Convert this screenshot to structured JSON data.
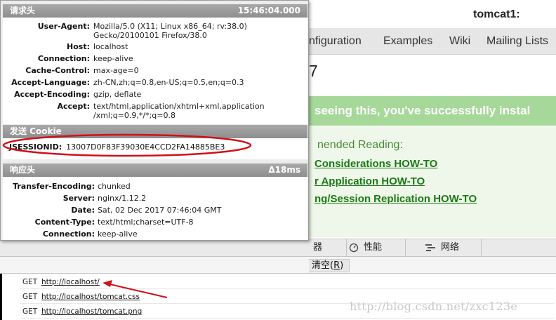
{
  "background_page": {
    "hostname": "tomcat1:",
    "nav": [
      "nfiguration",
      "Examples",
      "Wiki",
      "Mailing Lists"
    ],
    "title_fragment": "7",
    "banner": "seeing this, you've successfully instal",
    "recommended": "nended Reading:",
    "links": [
      "Considerations HOW-TO",
      "r Application HOW-TO",
      "ng/Session Replication HOW-TO"
    ]
  },
  "devtools": {
    "tabs": [
      {
        "icon": "",
        "label": "器"
      },
      {
        "icon": "performance-icon",
        "label": "性能"
      },
      {
        "icon": "network-icon",
        "label": "网络"
      }
    ],
    "clear_button": "清空(",
    "clear_key": "R",
    "clear_close": ")"
  },
  "network_log": [
    {
      "method": "GET",
      "url": "http://localhost/"
    },
    {
      "method": "GET",
      "url": "http://localhost/tomcat.css"
    },
    {
      "method": "GET",
      "url": "http://localhost/tomcat.png"
    }
  ],
  "watermark": "http://blog.csdn.net/zxc123e",
  "popup": {
    "request_title": "请求头",
    "request_time": "15:46:04.000",
    "request_headers": [
      {
        "key": "User-Agent:",
        "lines": [
          "Mozilla/5.0 (X11; Linux x86_64; rv:38.0)",
          "Gecko/20100101 Firefox/38.0"
        ]
      },
      {
        "key": "Host:",
        "lines": [
          "localhost"
        ]
      },
      {
        "key": "Connection:",
        "lines": [
          "keep-alive"
        ]
      },
      {
        "key": "Cache-Control:",
        "lines": [
          "max-age=0"
        ]
      },
      {
        "key": "Accept-Language:",
        "lines": [
          "zh-CN,zh;q=0.8,en-US;q=0.5,en;q=0.3"
        ]
      },
      {
        "key": "Accept-Encoding:",
        "lines": [
          "gzip, deflate"
        ]
      },
      {
        "key": "Accept:",
        "lines": [
          "text/html,application/xhtml+xml,application",
          "/xml;q=0.9,*/*;q=0.8"
        ]
      }
    ],
    "cookie_title": "发送 Cookie",
    "cookie": {
      "key": "JSESSIONID:",
      "value": "13007D0F83F39030E4CCD2FA14885BE3"
    },
    "response_title": "响应头",
    "response_time": "Δ18ms",
    "response_headers": [
      {
        "key": "Transfer-Encoding:",
        "value": "chunked"
      },
      {
        "key": "Server:",
        "value": "nginx/1.12.2"
      },
      {
        "key": "Date:",
        "value": "Sat, 02 Dec 2017 07:46:04 GMT"
      },
      {
        "key": "Content-Type:",
        "value": "text/html;charset=UTF-8"
      },
      {
        "key": "Connection:",
        "value": "keep-alive"
      }
    ]
  },
  "annotation_color": "#d0101a",
  "colors": {
    "banner": "#a6d89a",
    "link": "#1a7a15",
    "section_header": "#9a9a9a"
  }
}
